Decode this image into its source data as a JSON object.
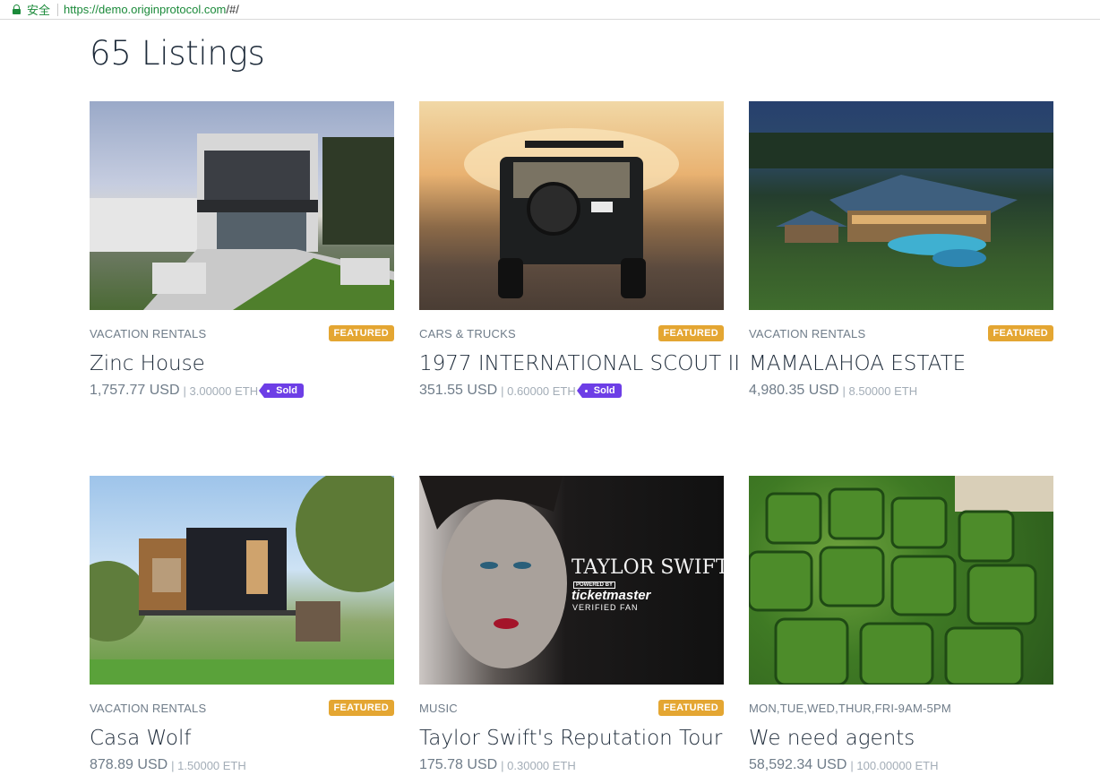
{
  "browser": {
    "secure_label": "安全",
    "url_host": "https://demo.originprotocol.com",
    "url_path": "/#/"
  },
  "page": {
    "title": "65 Listings"
  },
  "listings": [
    {
      "image": "modern zinc house",
      "category": "VACATION RENTALS",
      "badge": "FEATURED",
      "name": "Zinc House",
      "usd": "1,757.77 USD",
      "eth": "| 3.00000 ETH",
      "sold": "Sold"
    },
    {
      "image": "vintage suv at sunset",
      "category": "CARS & TRUCKS",
      "badge": "FEATURED",
      "name": "1977 INTERNATIONAL SCOUT II",
      "usd": "351.55 USD",
      "eth": "| 0.60000 ETH",
      "sold": "Sold"
    },
    {
      "image": "estate at dusk",
      "category": "VACATION RENTALS",
      "badge": "FEATURED",
      "name": "MAMALAHOA ESTATE",
      "usd": "4,980.35 USD",
      "eth": "| 8.50000 ETH"
    },
    {
      "image": "modern cabin in trees",
      "category": "VACATION RENTALS",
      "badge": "FEATURED",
      "name": "Casa Wolf",
      "usd": "878.89 USD",
      "eth": "| 1.50000 ETH"
    },
    {
      "image": "concert poster",
      "category": "MUSIC",
      "badge": "FEATURED",
      "name": "Taylor Swift's Reputation Tour",
      "usd": "175.78 USD",
      "eth": "| 0.30000 ETH",
      "poster": {
        "title": "TAYLOR SWIFT TO",
        "powered": "POWERED BY",
        "brand": "ticketmaster",
        "verified": "VERIFIED FAN"
      }
    },
    {
      "image": "square watermelons",
      "category": "MON,TUE,WED,THUR,FRI-9AM-5PM",
      "name": "We need agents",
      "usd": "58,592.34 USD",
      "eth": "| 100.00000 ETH"
    }
  ],
  "colors": {
    "featured": "#e4a632",
    "sold": "#6d3ee6",
    "secure": "#1b8a3a"
  }
}
